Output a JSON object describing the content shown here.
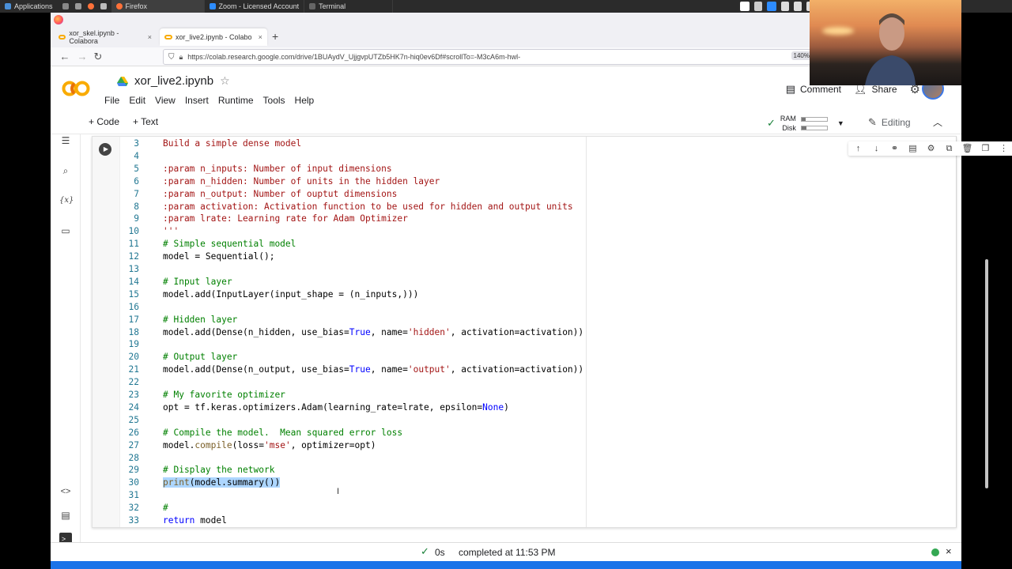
{
  "taskbar": {
    "applications": "Applications",
    "windows": [
      {
        "label": "Firefox",
        "active": true
      },
      {
        "label": "Zoom - Licensed Account",
        "active": false
      },
      {
        "label": "Terminal",
        "active": false
      }
    ]
  },
  "browser": {
    "tabs": [
      {
        "label": "xor_skel.ipynb - Colabora",
        "close": "×"
      },
      {
        "label": "xor_live2.ipynb - Colabo",
        "close": "×"
      }
    ],
    "new_tab": "+",
    "url": "https://colab.research.google.com/drive/1BUAydV_UjjgvpUTZb5HK7n-hiq0ev6Df#scrollTo=-M3cA6m-hwl-",
    "zoom": "140%"
  },
  "colab": {
    "notebook_title": "xor_live2.ipynb",
    "menu": [
      "File",
      "Edit",
      "View",
      "Insert",
      "Runtime",
      "Tools",
      "Help"
    ],
    "comment_label": "Comment",
    "share_label": "Share",
    "add_code": "+ Code",
    "add_text": "+ Text",
    "ram_label": "RAM",
    "disk_label": "Disk",
    "editing_label": "Editing"
  },
  "code_lines": [
    {
      "n": "3",
      "t": "Build a simple dense model"
    },
    {
      "n": "4",
      "t": ""
    },
    {
      "n": "5",
      "t": ":param n_inputs: Number of input dimensions"
    },
    {
      "n": "6",
      "t": ":param n_hidden: Number of units in the hidden layer"
    },
    {
      "n": "7",
      "t": ":param n_output: Number of ouptut dimensions"
    },
    {
      "n": "8",
      "t": ":param activation: Activation function to be used for hidden and output units"
    },
    {
      "n": "9",
      "t": ":param lrate: Learning rate for Adam Optimizer"
    },
    {
      "n": "10",
      "t": "'''"
    },
    {
      "n": "11",
      "t": "# Simple sequential model"
    },
    {
      "n": "12",
      "t": "model = Sequential();"
    },
    {
      "n": "13",
      "t": ""
    },
    {
      "n": "14",
      "t": "# Input layer"
    },
    {
      "n": "15",
      "t": "model.add(InputLayer(input_shape = (n_inputs,)))"
    },
    {
      "n": "16",
      "t": ""
    },
    {
      "n": "17",
      "t": "# Hidden layer"
    },
    {
      "n": "18",
      "t": "model.add(Dense(n_hidden, use_bias=True, name='hidden', activation=activation))"
    },
    {
      "n": "19",
      "t": ""
    },
    {
      "n": "20",
      "t": "# Output layer"
    },
    {
      "n": "21",
      "t": "model.add(Dense(n_output, use_bias=True, name='output', activation=activation))"
    },
    {
      "n": "22",
      "t": ""
    },
    {
      "n": "23",
      "t": "# My favorite optimizer"
    },
    {
      "n": "24",
      "t": "opt = tf.keras.optimizers.Adam(learning_rate=lrate, epsilon=None)"
    },
    {
      "n": "25",
      "t": ""
    },
    {
      "n": "26",
      "t": "# Compile the model.  Mean squared error loss"
    },
    {
      "n": "27",
      "t": "model.compile(loss='mse', optimizer=opt)"
    },
    {
      "n": "28",
      "t": ""
    },
    {
      "n": "29",
      "t": "# Display the network"
    },
    {
      "n": "30",
      "t": "print(model.summary())"
    },
    {
      "n": "31",
      "t": ""
    },
    {
      "n": "32",
      "t": "#"
    },
    {
      "n": "33",
      "t": "return model"
    }
  ],
  "status": {
    "check": "✓",
    "duration": "0s",
    "message": "completed at 11:53 PM",
    "close": "×"
  },
  "colors": {
    "accent": "#1a73e8",
    "colab_orange": "#f9ab00",
    "status_green": "#34a853"
  },
  "icons": {
    "run": "play-icon",
    "star": "star-icon",
    "drive": "drive-icon",
    "settings": "gear-icon"
  }
}
